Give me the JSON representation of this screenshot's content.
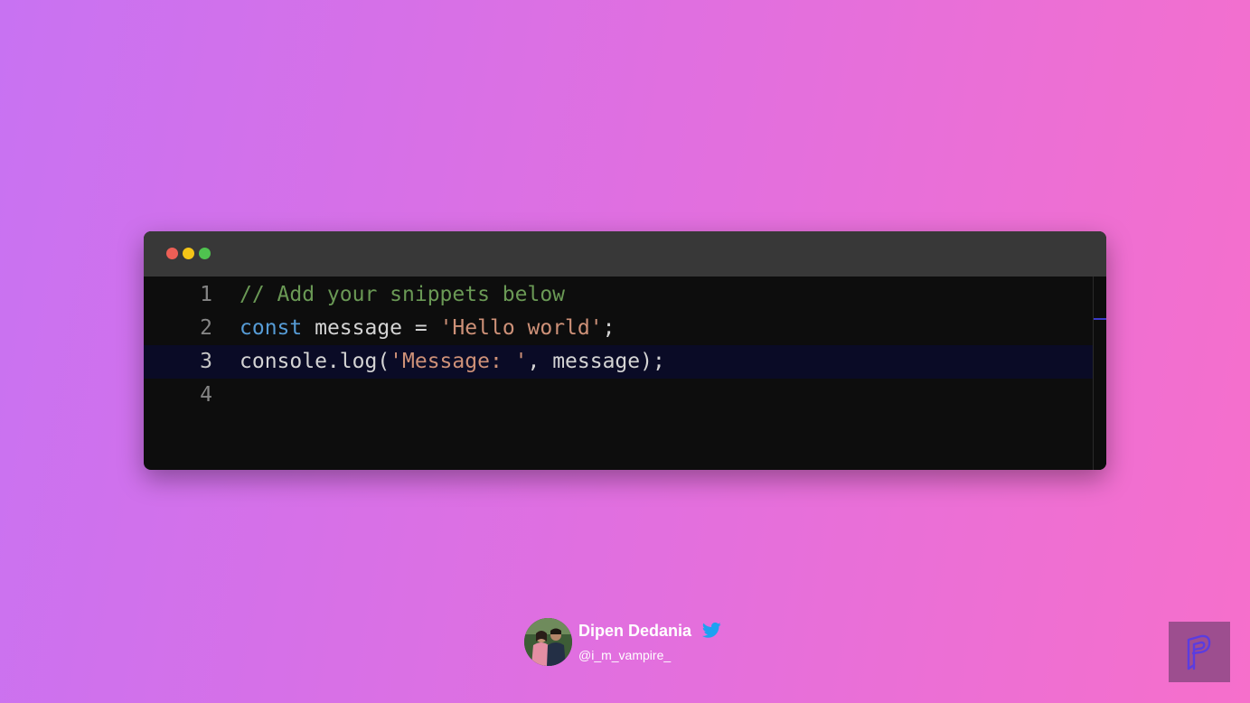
{
  "editor": {
    "window_controls": [
      {
        "name": "close",
        "color": "#ec5f56"
      },
      {
        "name": "minimize",
        "color": "#f5c517"
      },
      {
        "name": "maximize",
        "color": "#4fc34f"
      }
    ],
    "lines": [
      {
        "number": "1",
        "tokens": [
          {
            "type": "comment",
            "text": "// Add your snippets below"
          }
        ]
      },
      {
        "number": "2",
        "tokens": [
          {
            "type": "keyword",
            "text": "const"
          },
          {
            "type": "plain",
            "text": " message = "
          },
          {
            "type": "string",
            "text": "'Hello world'"
          },
          {
            "type": "plain",
            "text": ";"
          }
        ]
      },
      {
        "number": "3",
        "active": true,
        "tokens": [
          {
            "type": "plain",
            "text": "console.log("
          },
          {
            "type": "string",
            "text": "'Message: '"
          },
          {
            "type": "plain",
            "text": ", message);"
          }
        ]
      },
      {
        "number": "4",
        "tokens": []
      }
    ],
    "colors": {
      "background": "#0d0d0d",
      "titlebar": "#383838",
      "active_line": "#0a0b26",
      "comment": "#6a9955",
      "keyword": "#569cd6",
      "string": "#ce9178",
      "plain": "#d4d4d4"
    }
  },
  "author": {
    "name": "Dipen Dedania",
    "handle": "@i_m_vampire_",
    "badge_icon": "twitter-bird-icon",
    "avatar_icon": "profile-photo"
  },
  "brand": {
    "icon": "brand-p-logo-icon",
    "color": "#9d4e8f"
  }
}
